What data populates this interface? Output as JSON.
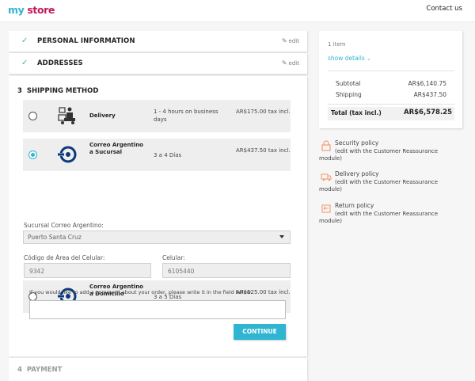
{
  "header": {
    "logo_my": "my",
    "logo_store": "store",
    "contact_label": "Contact us"
  },
  "steps": {
    "personal": {
      "title": "PERSONAL INFORMATION",
      "edit_label": "edit",
      "status_icon": "check-icon"
    },
    "addresses": {
      "title": "ADDRESSES",
      "edit_label": "edit",
      "status_icon": "check-icon"
    },
    "shipping": {
      "number": "3",
      "title": "SHIPPING METHOD"
    },
    "payment": {
      "number": "4",
      "title": "PAYMENT"
    }
  },
  "carriers": [
    {
      "name": "Delivery",
      "delay": "1 - 4 hours on business days",
      "price": "AR$175.00 tax incl.",
      "selected": false,
      "icon": "delivery-truck-icon"
    },
    {
      "name": "Correo Argentino a Sucursal",
      "delay": "3 a 4 Días",
      "price": "AR$437.50 tax incl.",
      "selected": true,
      "icon": "correo-argentino-logo"
    },
    {
      "name": "Correo Argentino a Domicilio",
      "delay": "3 a 5 Días",
      "price": "AR$525.00 tax incl.",
      "selected": false,
      "icon": "correo-argentino-logo"
    }
  ],
  "sucursal": {
    "label": "Sucursal Correo Argentino:",
    "selected": "Puerto Santa Cruz"
  },
  "phone": {
    "area_label": "Código de Área del Celular:",
    "area_value": "9342",
    "cell_label": "Celular:",
    "cell_value": "6105440"
  },
  "comment": {
    "label": "If you would like to add a comment about your order, please write it in the field below.",
    "value": ""
  },
  "continue_label": "CONTINUE",
  "summary": {
    "items_count": "1 item",
    "show_details": "show details",
    "subtotal_label": "Subtotal",
    "subtotal_value": "AR$6,140.75",
    "shipping_label": "Shipping",
    "shipping_value": "AR$437.50",
    "total_label": "Total (tax incl.)",
    "total_value": "AR$6,578.25"
  },
  "reassurance": [
    {
      "title": "Security policy",
      "desc": "(edit with the Customer Reassurance",
      "desc2": "module)",
      "icon": "security-lock-icon"
    },
    {
      "title": "Delivery policy",
      "desc": "(edit with the Customer Reassurance",
      "desc2": "module)",
      "icon": "delivery-truck-icon"
    },
    {
      "title": "Return policy",
      "desc": "(edit with the Customer Reassurance",
      "desc2": "module)",
      "icon": "return-icon"
    }
  ],
  "colors": {
    "accent": "#2fb5d2",
    "brand_store": "#c2185b",
    "check": "#4cbb6c",
    "reassurance_icon": "#f39d72"
  }
}
